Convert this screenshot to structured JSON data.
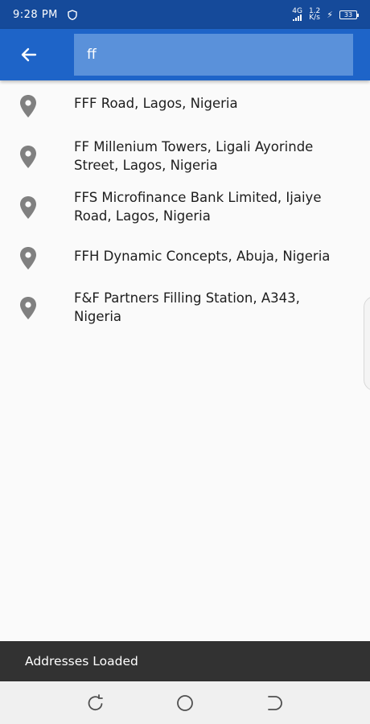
{
  "status_bar": {
    "time": "9:28 PM",
    "network": "4G",
    "speed_value": "1.2",
    "speed_unit": "K/s",
    "battery": "33"
  },
  "search": {
    "query": "ff"
  },
  "results": [
    {
      "line1": "FFF Road, Lagos, Nigeria",
      "line2": ""
    },
    {
      "line1": "FF Millenium Towers, Ligali Ayorinde",
      "line2": "Street, Lagos, Nigeria"
    },
    {
      "line1": "FFS Microfinance Bank Limited, Ijaiye",
      "line2": "Road, Lagos, Nigeria"
    },
    {
      "line1": "FFH Dynamic Concepts, Abuja, Nigeria",
      "line2": ""
    },
    {
      "line1": "F&F Partners Filling Station, A343,",
      "line2": "Nigeria"
    }
  ],
  "snackbar": {
    "message": "Addresses Loaded"
  },
  "colors": {
    "status_bar": "#154a9a",
    "app_bar": "#1e64c8",
    "search_field": "#5a91da",
    "pin": "#808080",
    "snackbar": "#323232"
  },
  "icons": [
    "shield-icon",
    "back-arrow-icon",
    "location-pin-icon",
    "recents-icon",
    "home-icon",
    "back-nav-icon"
  ]
}
